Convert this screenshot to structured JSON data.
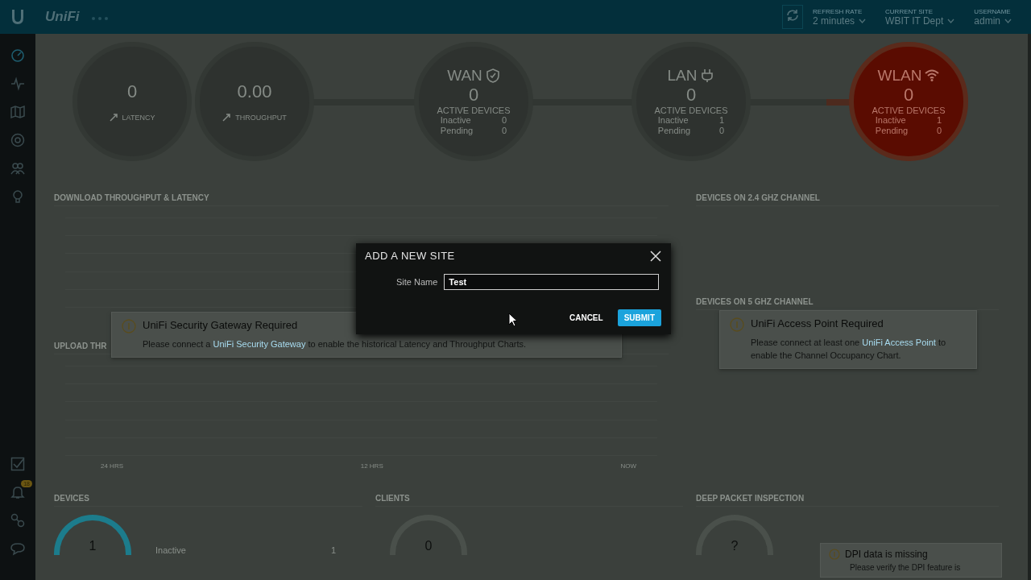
{
  "topbar": {
    "logo": "UniFi",
    "fields": [
      {
        "label": "REFRESH RATE",
        "value": "2 minutes"
      },
      {
        "label": "CURRENT SITE",
        "value": "WBIT IT Dept"
      },
      {
        "label": "USERNAME",
        "value": "admin"
      }
    ]
  },
  "sidebar": {
    "top": [
      {
        "selected": true
      },
      {
        "selected": false
      },
      {
        "selected": false
      },
      {
        "selected": false
      },
      {
        "selected": false
      },
      {
        "selected": false
      }
    ],
    "bottom": [
      {
        "selected": false
      },
      {
        "selected": false,
        "badge": "18"
      },
      {
        "selected": false
      },
      {
        "selected": false
      }
    ]
  },
  "circles": [
    {
      "kind": "stat",
      "value": "0",
      "label": "LATENCY"
    },
    {
      "kind": "stat",
      "value": "0.00",
      "label": "THROUGHPUT"
    },
    {
      "kind": "network",
      "title": "WAN",
      "value": "0",
      "label": "ACTIVE DEVICES",
      "active": false,
      "rows": [
        {
          "name": "Inactive",
          "value": "0"
        },
        {
          "name": "Pending",
          "value": "0"
        }
      ]
    },
    {
      "kind": "network",
      "title": "LAN",
      "value": "0",
      "label": "ACTIVE DEVICES",
      "active": false,
      "rows": [
        {
          "name": "Inactive",
          "value": "1"
        },
        {
          "name": "Pending",
          "value": "0"
        }
      ]
    },
    {
      "kind": "network",
      "title": "WLAN",
      "value": "0",
      "label": "ACTIVE DEVICES",
      "active": true,
      "rows": [
        {
          "name": "Inactive",
          "value": "1"
        },
        {
          "name": "Pending",
          "value": "0"
        }
      ]
    }
  ],
  "charts": [
    {
      "title": "DOWNLOAD THROUGHPUT & LATENCY"
    },
    {
      "title": "UPLOAD THR",
      "xlabels": [
        "24 HRS",
        "12 HRS",
        "NOW"
      ]
    }
  ],
  "channels": [
    {
      "title": "DEVICES ON 2.4 GHZ CHANNEL"
    },
    {
      "title": "DEVICES ON 5 GHZ CHANNEL"
    }
  ],
  "notices": [
    {
      "title": "UniFi Security Gateway Required",
      "before": "Please connect a ",
      "link": "UniFi Security Gateway",
      "after": " to enable the historical Latency and Throughput Charts."
    },
    {
      "title": "UniFi Access Point Required",
      "before": "Please connect at least one ",
      "link": "UniFi Access Point",
      "after": " to enable the Channel Occupancy Chart."
    }
  ],
  "bottom": [
    {
      "title": "DEVICES",
      "value": "1",
      "legend": {
        "name": "Inactive",
        "value": "1"
      }
    },
    {
      "title": "CLIENTS",
      "value": "0"
    },
    {
      "title": "DEEP PACKET INSPECTION",
      "value": "?",
      "notice": {
        "title": "DPI data is missing",
        "text": "Please verify the DPI feature is"
      }
    }
  ],
  "dialog": {
    "title": "ADD A NEW SITE",
    "field": {
      "label": "Site Name",
      "value": "Test"
    },
    "buttons": [
      {
        "label": "CANCEL",
        "kind": "secondary"
      },
      {
        "label": "SUBMIT",
        "kind": "primary"
      }
    ]
  }
}
